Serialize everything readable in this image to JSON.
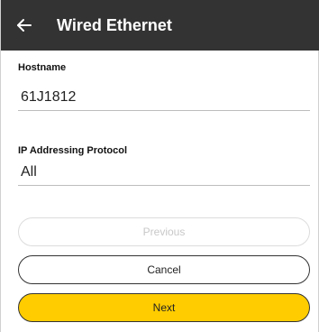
{
  "appbar": {
    "title": "Wired Ethernet",
    "back_icon": "arrow-left-icon",
    "background": "#333333"
  },
  "form": {
    "hostname": {
      "label": "Hostname",
      "value": "61J1812"
    },
    "ip_protocol": {
      "label": "IP Addressing Protocol",
      "value": "All"
    }
  },
  "buttons": {
    "previous": {
      "label": "Previous",
      "enabled": false
    },
    "cancel": {
      "label": "Cancel"
    },
    "next": {
      "label": "Next",
      "color": "#ffcc00"
    }
  }
}
